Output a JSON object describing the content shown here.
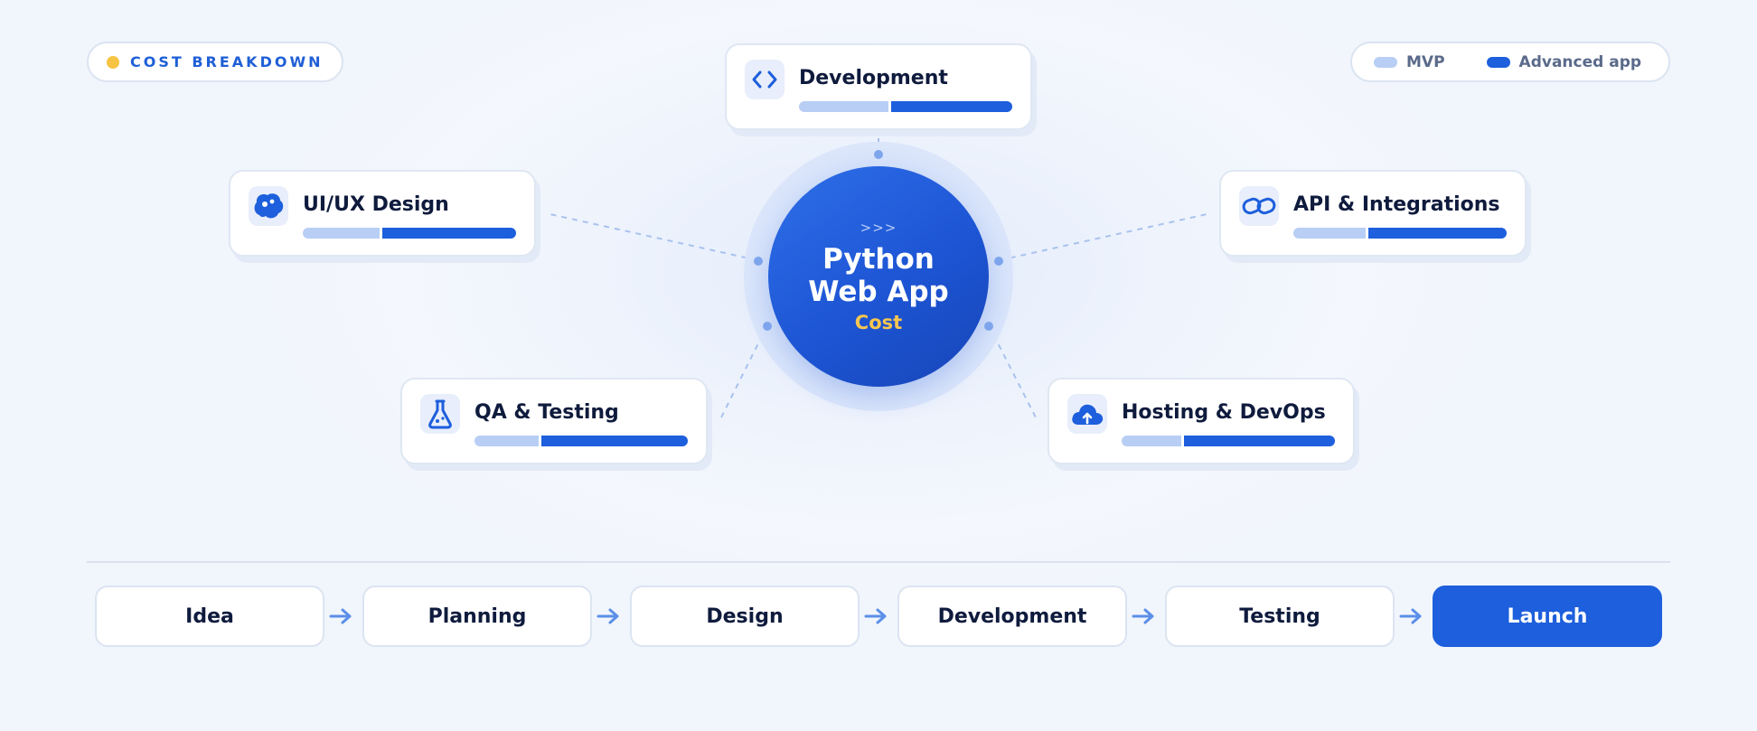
{
  "header": {
    "badge_label": "COST BREAKDOWN",
    "badge_dot_color": "#f6c343"
  },
  "legend": {
    "items": [
      {
        "label": "MVP",
        "color": "#b8cef5"
      },
      {
        "label": "Advanced app",
        "color": "#1d5fdc"
      }
    ]
  },
  "hub": {
    "chevrons": ">>>",
    "line1": "Python",
    "line2": "Web App",
    "subtitle": "Cost"
  },
  "nodes": [
    {
      "key": "development",
      "title": "Development",
      "icon": "code-icon",
      "mvp_share": 0.42
    },
    {
      "key": "uiux",
      "title": "UI/UX Design",
      "icon": "brain-icon",
      "mvp_share": 0.36
    },
    {
      "key": "api",
      "title": "API & Integrations",
      "icon": "link-icon",
      "mvp_share": 0.34
    },
    {
      "key": "qa",
      "title": "QA & Testing",
      "icon": "flask-icon",
      "mvp_share": 0.3
    },
    {
      "key": "hosting",
      "title": "Hosting & DevOps",
      "icon": "cloud-upload-icon",
      "mvp_share": 0.28
    }
  ],
  "timeline": {
    "steps": [
      "Idea",
      "Planning",
      "Design",
      "Development",
      "Testing",
      "Launch"
    ],
    "active_step": "Launch"
  },
  "colors": {
    "accent": "#1d5fdc",
    "accent_light": "#b8cef5",
    "highlight": "#f7c650",
    "text": "#0f1b3d"
  }
}
